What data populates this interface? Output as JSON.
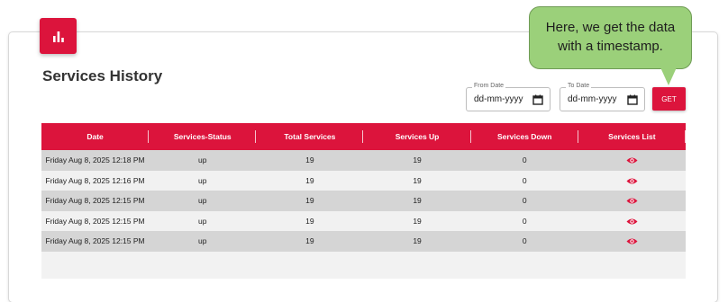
{
  "logo": {
    "icon": "bar-chart-icon",
    "color": "#dc143c"
  },
  "header": {
    "title": "Services History"
  },
  "filters": {
    "from_date": {
      "label": "From Date",
      "placeholder": "dd-mm-yyyy"
    },
    "to_date": {
      "label": "To Date",
      "placeholder": "dd-mm-yyyy"
    },
    "get_label": "GET"
  },
  "table": {
    "columns": [
      "Date",
      "Services-Status",
      "Total Services",
      "Services Up",
      "Services Down",
      "Services List"
    ],
    "rows": [
      {
        "date": "Friday Aug 8, 2025 12:18 PM",
        "status": "up",
        "total": "19",
        "up": "19",
        "down": "0",
        "list_icon": "eye-icon"
      },
      {
        "date": "Friday Aug 8, 2025 12:16 PM",
        "status": "up",
        "total": "19",
        "up": "19",
        "down": "0",
        "list_icon": "eye-icon"
      },
      {
        "date": "Friday Aug 8, 2025 12:15 PM",
        "status": "up",
        "total": "19",
        "up": "19",
        "down": "0",
        "list_icon": "eye-icon"
      },
      {
        "date": "Friday Aug 8, 2025 12:15 PM",
        "status": "up",
        "total": "19",
        "up": "19",
        "down": "0",
        "list_icon": "eye-icon"
      },
      {
        "date": "Friday Aug 8, 2025 12:15 PM",
        "status": "up",
        "total": "19",
        "up": "19",
        "down": "0",
        "list_icon": "eye-icon"
      }
    ]
  },
  "callout": {
    "line1": "Here, we get the data",
    "line2": "with a timestamp."
  },
  "colors": {
    "accent": "#dc143c",
    "callout_fill": "#9bd07a"
  }
}
